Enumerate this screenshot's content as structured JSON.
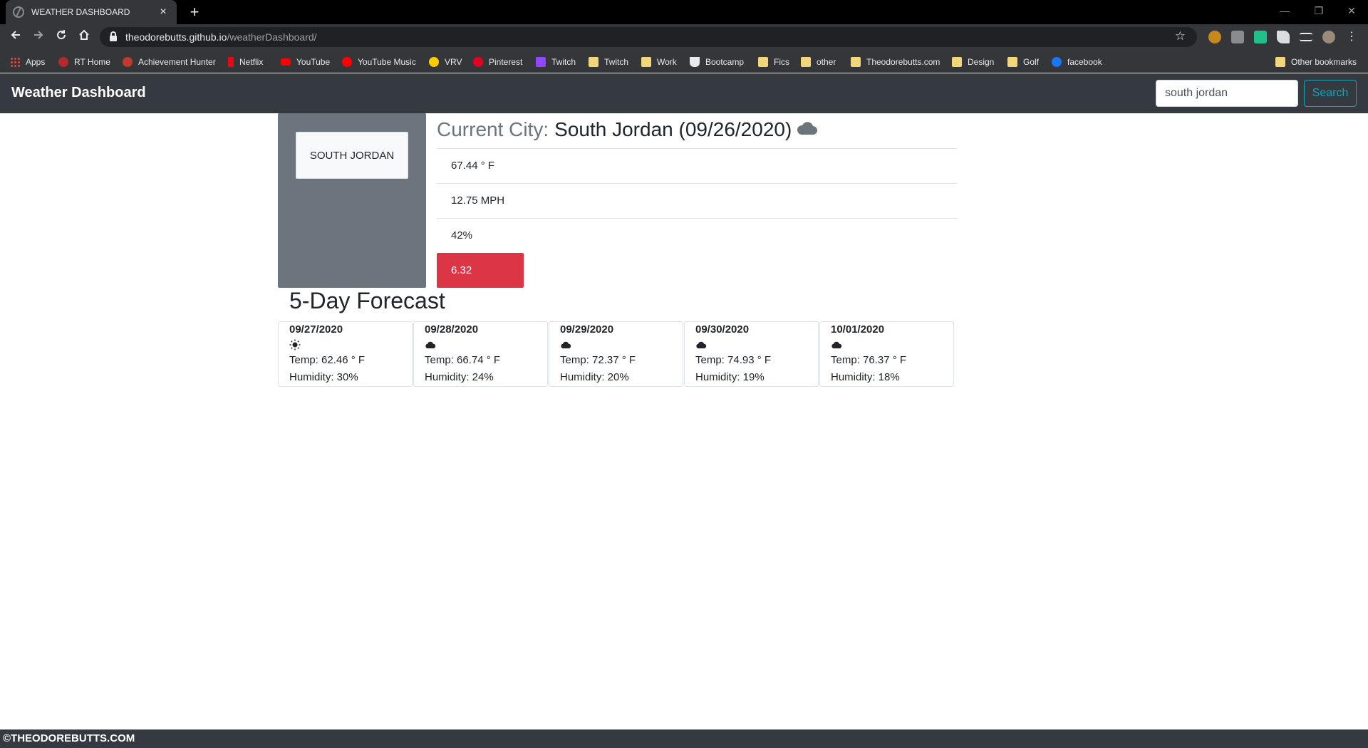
{
  "browser": {
    "tab_title": "WEATHER DASHBOARD",
    "tab_close": "×",
    "new_tab": "+",
    "url_host": "theodorebutts.github.io",
    "url_path": "/weatherDashboard/",
    "window_controls": [
      "—",
      "❐",
      "✕"
    ],
    "bookmarks": [
      {
        "label": "Apps",
        "icon": "apps-grid-icon"
      },
      {
        "label": "RT Home",
        "icon": "rooster-teeth-icon"
      },
      {
        "label": "Achievement Hunter",
        "icon": "achievement-hunter-icon"
      },
      {
        "label": "Netflix",
        "icon": "netflix-icon"
      },
      {
        "label": "YouTube",
        "icon": "youtube-icon"
      },
      {
        "label": "YouTube Music",
        "icon": "youtube-music-icon"
      },
      {
        "label": "VRV",
        "icon": "vrv-icon"
      },
      {
        "label": "Pinterest",
        "icon": "pinterest-icon"
      },
      {
        "label": "Twitch",
        "icon": "twitch-icon"
      },
      {
        "label": "Twitch",
        "icon": "folder-icon"
      },
      {
        "label": "Work",
        "icon": "folder-icon"
      },
      {
        "label": "Bootcamp",
        "icon": "bootcamp-icon"
      },
      {
        "label": "Fics",
        "icon": "folder-icon"
      },
      {
        "label": "other",
        "icon": "folder-icon"
      },
      {
        "label": "Theodorebutts.com",
        "icon": "folder-icon"
      },
      {
        "label": "Design",
        "icon": "folder-icon"
      },
      {
        "label": "Golf",
        "icon": "folder-icon"
      },
      {
        "label": "facebook",
        "icon": "facebook-icon"
      }
    ],
    "other_bookmarks": "Other bookmarks"
  },
  "site": {
    "brand": "Weather Dashboard",
    "search": {
      "value": "south jordan",
      "button": "Search"
    },
    "saved_cities": [
      "SOUTH JORDAN"
    ],
    "current": {
      "label": "Current City:",
      "city_date": "South Jordan (09/26/2020)",
      "icon": "cloud-icon",
      "temperature": "67.44 ° F",
      "wind": "12.75 MPH",
      "humidity": "42%",
      "uv_index": "6.32"
    },
    "forecast_heading": "5-Day Forecast",
    "forecast": [
      {
        "date": "09/27/2020",
        "icon": "sun-icon",
        "temp": "Temp: 62.46 ° F",
        "humidity": "Humidity: 30%"
      },
      {
        "date": "09/28/2020",
        "icon": "cloud-icon",
        "temp": "Temp: 66.74 ° F",
        "humidity": "Humidity: 24%"
      },
      {
        "date": "09/29/2020",
        "icon": "cloud-icon",
        "temp": "Temp: 72.37 ° F",
        "humidity": "Humidity: 20%"
      },
      {
        "date": "09/30/2020",
        "icon": "cloud-icon",
        "temp": "Temp: 74.93 ° F",
        "humidity": "Humidity: 19%"
      },
      {
        "date": "10/01/2020",
        "icon": "cloud-icon",
        "temp": "Temp: 76.37 ° F",
        "humidity": "Humidity: 18%"
      }
    ],
    "footer": "©THEODOREBUTTS.COM"
  },
  "colors": {
    "navbar": "#343a40",
    "city_panel": "#6c757d",
    "uv_high": "#dc3545",
    "search_accent": "#17a2b8"
  }
}
